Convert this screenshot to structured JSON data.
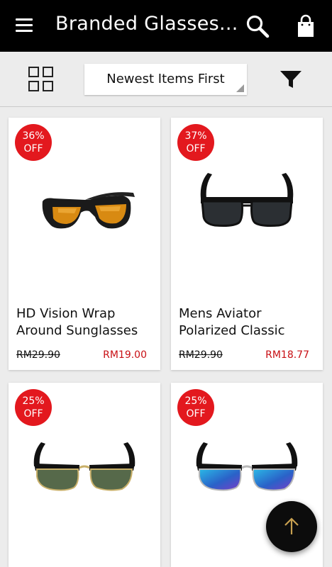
{
  "appbar": {
    "title": "Branded Glasses...",
    "icons": [
      "menu-icon",
      "search-icon",
      "shopping-bag-icon"
    ]
  },
  "toolbar": {
    "sort_label": "Newest Items First",
    "icons": [
      "grid-view-icon",
      "filter-icon"
    ]
  },
  "products": [
    {
      "badge_pct": "36%",
      "badge_off": "OFF",
      "name": "HD Vision Wrap Around Sunglasses",
      "old_price": "RM29.90",
      "new_price": "RM19.00"
    },
    {
      "badge_pct": "37%",
      "badge_off": "OFF",
      "name": "Mens Aviator Polarized Classic",
      "old_price": "RM29.90",
      "new_price": "RM18.77"
    },
    {
      "badge_pct": "25%",
      "badge_off": "OFF"
    },
    {
      "badge_pct": "25%",
      "badge_off": "OFF"
    }
  ],
  "fab": {
    "icon": "arrow-up-icon"
  },
  "colors": {
    "appbar": "#000000",
    "badge": "#e3181e",
    "sale_price": "#c80f14",
    "fab_arrow": "#c8a050"
  }
}
